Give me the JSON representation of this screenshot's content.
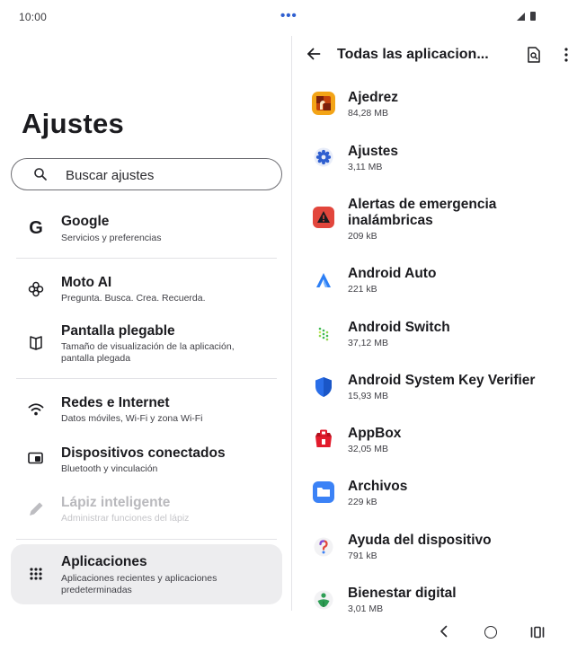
{
  "status_bar": {
    "time": "10:00",
    "center_indicator": "•••"
  },
  "settings": {
    "title": "Ajustes",
    "search_placeholder": "Buscar ajustes",
    "items": [
      {
        "icon": "google-g-icon",
        "title": "Google",
        "subtitle": "Servicios y preferencias"
      },
      {
        "icon": "moto-ai-icon",
        "title": "Moto AI",
        "subtitle": "Pregunta. Busca. Crea. Recuerda."
      },
      {
        "icon": "foldable-display-icon",
        "title": "Pantalla plegable",
        "subtitle": "Tamaño de visualización de la aplicación, pantalla plegada"
      },
      {
        "icon": "wifi-icon",
        "title": "Redes e Internet",
        "subtitle": "Datos móviles, Wi-Fi y zona Wi-Fi"
      },
      {
        "icon": "connected-devices-icon",
        "title": "Dispositivos conectados",
        "subtitle": "Bluetooth y vinculación"
      },
      {
        "icon": "pen-icon",
        "title": "Lápiz inteligente",
        "subtitle": "Administrar funciones del lápiz",
        "disabled": true
      },
      {
        "icon": "apps-grid-icon",
        "title": "Aplicaciones",
        "subtitle": "Aplicaciones recientes y aplicaciones predeterminadas",
        "selected": true
      }
    ]
  },
  "apps_panel": {
    "title": "Todas las aplicacion...",
    "apps": [
      {
        "name": "Ajedrez",
        "size": "84,28 MB",
        "icon": "chess-app-icon"
      },
      {
        "name": "Ajustes",
        "size": "3,11 MB",
        "icon": "settings-gear-icon"
      },
      {
        "name": "Alertas de emergencia inalámbricas",
        "size": "209 kB",
        "icon": "emergency-alert-icon"
      },
      {
        "name": "Android Auto",
        "size": "221 kB",
        "icon": "android-auto-icon"
      },
      {
        "name": "Android Switch",
        "size": "37,12 MB",
        "icon": "android-switch-icon"
      },
      {
        "name": "Android System Key Verifier",
        "size": "15,93 MB",
        "icon": "shield-icon"
      },
      {
        "name": "AppBox",
        "size": "32,05 MB",
        "icon": "appbox-icon"
      },
      {
        "name": "Archivos",
        "size": "229 kB",
        "icon": "folder-icon"
      },
      {
        "name": "Ayuda del dispositivo",
        "size": "791 kB",
        "icon": "question-icon"
      },
      {
        "name": "Bienestar digital",
        "size": "3,01 MB",
        "icon": "digital-wellbeing-icon"
      }
    ]
  },
  "colors": {
    "accent": "#2f5fd0",
    "selected_bg": "#ededef",
    "alert_red": "#e2463c",
    "shield_blue": "#2a6ee8"
  }
}
